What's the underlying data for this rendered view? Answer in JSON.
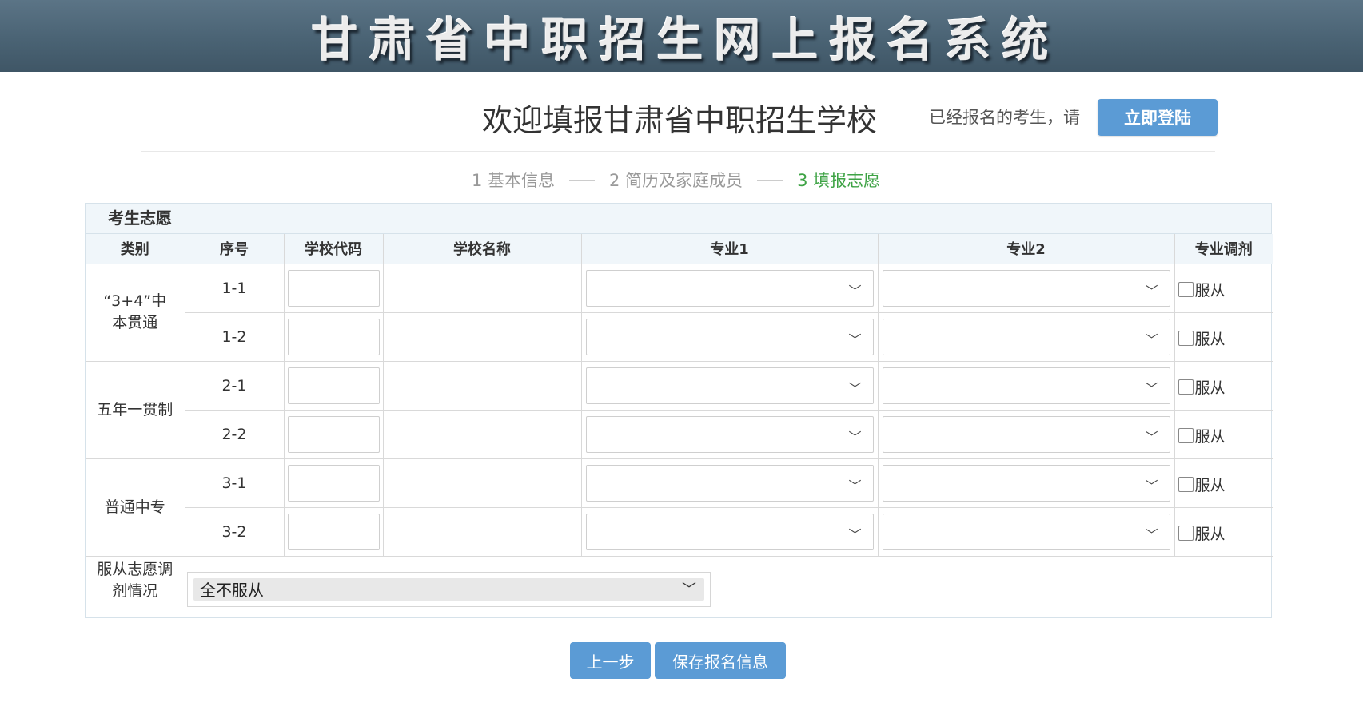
{
  "banner": {
    "title": "甘肃省中职招生网上报名系统"
  },
  "header": {
    "welcome": "欢迎填报甘肃省中职招生学校",
    "login_prompt": "已经报名的考生，请",
    "login_button": "立即登陆"
  },
  "steps": [
    {
      "label": "1 基本信息",
      "active": false
    },
    {
      "label": "2 简历及家庭成员",
      "active": false
    },
    {
      "label": "3 填报志愿",
      "active": true
    }
  ],
  "form": {
    "section_title": "考生志愿",
    "columns": [
      "类别",
      "序号",
      "学校代码",
      "学校名称",
      "专业1",
      "专业2",
      "专业调剂"
    ],
    "groups": [
      {
        "category_line1": "“3+4”中",
        "category_line2": "本贯通",
        "rows": [
          "1-1",
          "1-2"
        ]
      },
      {
        "category_line1": "五年一贯制",
        "category_line2": "",
        "rows": [
          "2-1",
          "2-2"
        ]
      },
      {
        "category_line1": "普通中专",
        "category_line2": "",
        "rows": [
          "3-1",
          "3-2"
        ]
      }
    ],
    "adjust_checkbox_label": "服从",
    "obey_label_line1": "服从志愿调",
    "obey_label_line2": "剂情况",
    "obey_selected": "全不服从"
  },
  "buttons": {
    "prev": "上一步",
    "save": "保存报名信息"
  },
  "colors": {
    "banner": "#4a6374",
    "accent": "#5b9bd5",
    "active_step": "#3ea345"
  }
}
